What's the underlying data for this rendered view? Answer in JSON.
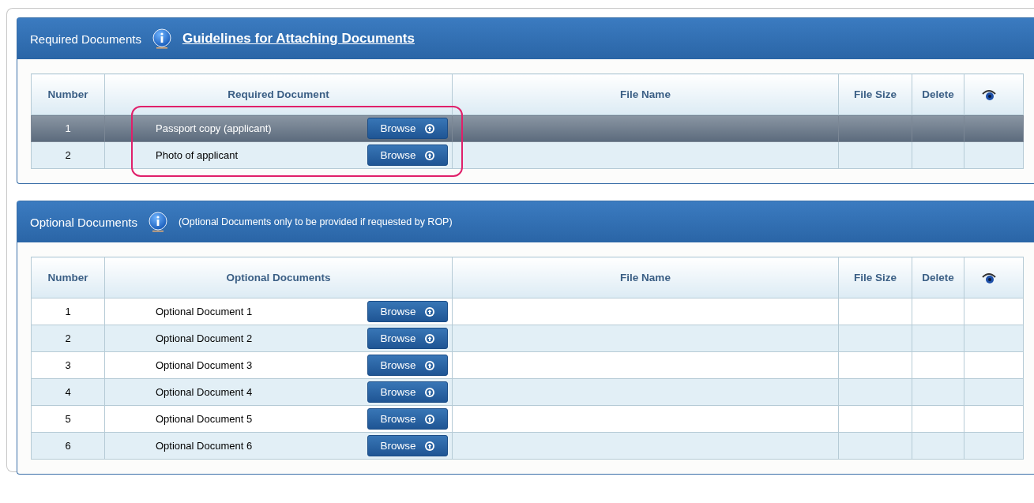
{
  "sections": [
    {
      "title": "Required Documents",
      "kind": "link",
      "note": "Guidelines for Attaching Documents",
      "highlight": true,
      "columns": [
        "Number",
        "Required Document",
        "File Name",
        "File Size",
        "Delete"
      ],
      "rows": [
        {
          "number": "1",
          "document": "Passport copy (applicant)",
          "button": "Browse",
          "selected": true
        },
        {
          "number": "2",
          "document": "Photo of applicant",
          "button": "Browse",
          "selected": false
        }
      ]
    },
    {
      "title": "Optional Documents",
      "kind": "text",
      "note": "(Optional Documents only to be provided if requested by ROP)",
      "highlight": false,
      "columns": [
        "Number",
        "Optional Documents",
        "File Name",
        "File Size",
        "Delete"
      ],
      "rows": [
        {
          "number": "1",
          "document": "Optional Document 1",
          "button": "Browse",
          "selected": false
        },
        {
          "number": "2",
          "document": "Optional Document 2",
          "button": "Browse",
          "selected": false
        },
        {
          "number": "3",
          "document": "Optional Document 3",
          "button": "Browse",
          "selected": false
        },
        {
          "number": "4",
          "document": "Optional Document 4",
          "button": "Browse",
          "selected": false
        },
        {
          "number": "5",
          "document": "Optional Document 5",
          "button": "Browse",
          "selected": false
        },
        {
          "number": "6",
          "document": "Optional Document 6",
          "button": "Browse",
          "selected": false
        }
      ]
    }
  ]
}
